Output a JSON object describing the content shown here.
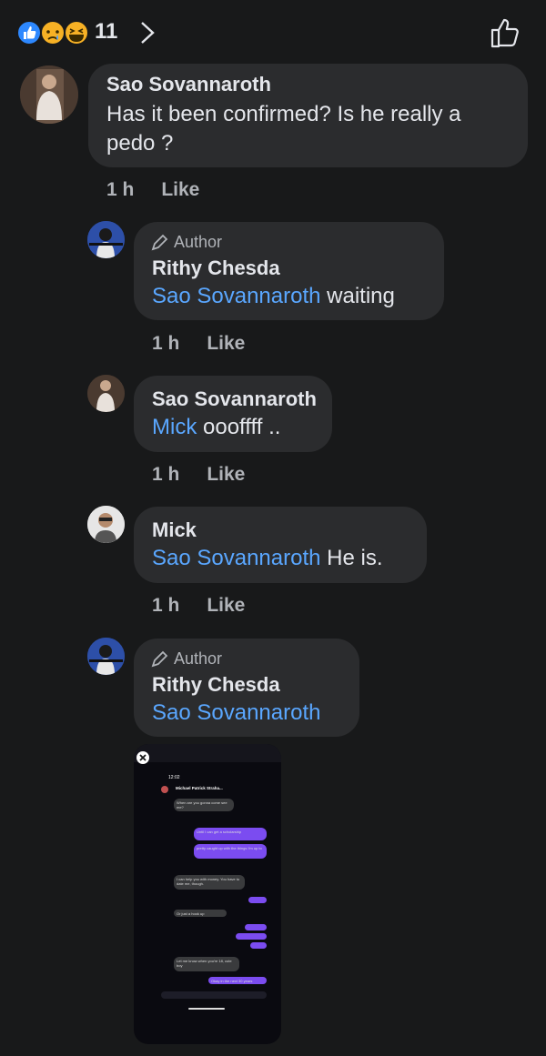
{
  "reactions": {
    "count": "11",
    "icons": [
      "like-reaction-icon",
      "sad-reaction-icon",
      "haha-reaction-icon"
    ]
  },
  "comments": [
    {
      "name": "Sao Sovannaroth",
      "text_line1": "Has it been confirmed? Is he really a",
      "text_line2": "pedo ?",
      "time": "1 h",
      "like": "Like"
    },
    {
      "badge": "Author",
      "name": "Rithy Chesda",
      "mention": "Sao Sovannaroth",
      "text": "waiting",
      "time": "1 h",
      "like": "Like"
    },
    {
      "name": "Sao Sovannaroth",
      "mention": "Mick",
      "text": "oooffff ..",
      "time": "1 h",
      "like": "Like"
    },
    {
      "name": "Mick",
      "mention": "Sao Sovannaroth",
      "text": "He is.",
      "time": "1 h",
      "like": "Like"
    },
    {
      "badge": "Author",
      "name": "Rithy Chesda",
      "mention": "Sao Sovannaroth"
    }
  ],
  "attachment": {
    "status_time": "12:02",
    "chat_name": "Michael Patrick Straha...",
    "messages": [
      "When are you gonna come see me?",
      "Until I can get a scholarship",
      "pretty caught up with the things I'm up to",
      "I can help you with money. You have to date me, though.",
      "Or just a hook up",
      "Let me know when you're 18, cute boy",
      "Okay in the next 30 years"
    ]
  },
  "colors": {
    "background": "#18191a",
    "bubble": "#2b2c2e",
    "mention": "#5aa7ff",
    "meta": "#b0b3b8"
  }
}
